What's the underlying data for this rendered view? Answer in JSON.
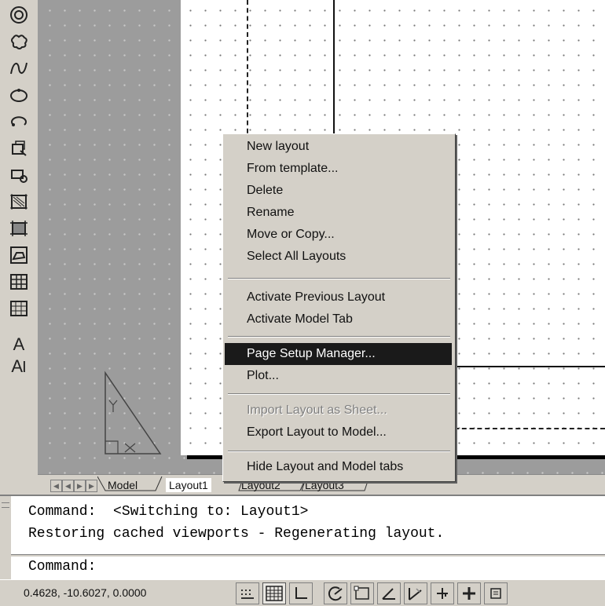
{
  "toolbar": {
    "icons": [
      "donut-icon",
      "revision-cloud-icon",
      "spline-icon",
      "ellipse-icon",
      "ellipse-arc-icon",
      "insert-block-icon",
      "make-block-icon",
      "point-icon",
      "hatch-icon",
      "gradient-icon",
      "region-icon",
      "table-icon",
      "multiline-text-icon",
      "add-selected-text-icon"
    ],
    "text_a": "A",
    "text_ai": "A"
  },
  "tabs": {
    "model": "Model",
    "layout1": "Layout1",
    "layout2": "Layout2",
    "layout3": "Layout3",
    "active": "Layout1"
  },
  "context_menu": {
    "items": [
      {
        "label": "New layout"
      },
      {
        "label": "From template..."
      },
      {
        "label": "Delete"
      },
      {
        "label": "Rename"
      },
      {
        "label": "Move or Copy..."
      },
      {
        "label": "Select All Layouts"
      },
      {
        "label": "Activate Previous Layout"
      },
      {
        "label": "Activate Model Tab"
      },
      {
        "label": "Page Setup Manager...",
        "highlighted": true
      },
      {
        "label": "Plot..."
      },
      {
        "label": "Import Layout as Sheet...",
        "disabled": true
      },
      {
        "label": "Export Layout to Model..."
      },
      {
        "label": "Hide Layout and Model tabs"
      }
    ]
  },
  "command": {
    "line1": "Command:  <Switching to: Layout1>",
    "line2": "Restoring cached viewports - Regenerating layout.",
    "prompt": "Command:",
    "input_value": ""
  },
  "status": {
    "coordinates": "0.4628, -10.6027, 0.0000",
    "toggles": [
      "snap-icon",
      "grid-icon",
      "ortho-icon",
      "polar-icon",
      "osnap-icon",
      "otrack-icon",
      "ducs-icon",
      "dyn-icon",
      "lwt-icon",
      "model-icon"
    ]
  },
  "colors": {
    "menu_highlight": "#1a1a1a",
    "paper": "#ffffff",
    "model_space": "#9c9c9c",
    "chrome": "#d4d0c8"
  }
}
